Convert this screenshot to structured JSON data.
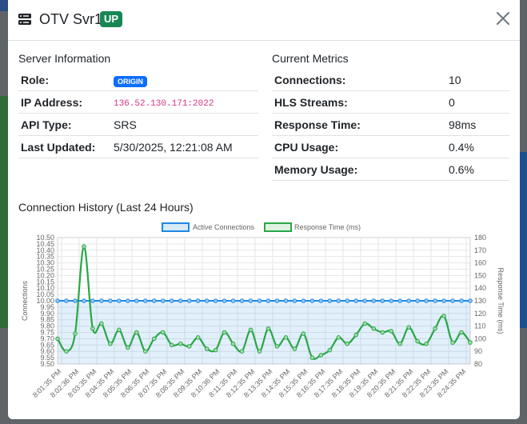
{
  "modal": {
    "title": "OTV Svr1",
    "status_badge": "UP",
    "close_icon": "close-icon",
    "server_icon": "server-icon"
  },
  "server_info": {
    "heading": "Server Information",
    "rows": [
      {
        "label": "Role:",
        "value": "ORIGIN"
      },
      {
        "label": "IP Address:",
        "value": "136.52.130.171:2022"
      },
      {
        "label": "API Type:",
        "value": "SRS"
      },
      {
        "label": "Last Updated:",
        "value": "5/30/2025, 12:21:08 AM"
      }
    ]
  },
  "metrics": {
    "heading": "Current Metrics",
    "rows": [
      {
        "label": "Connections:",
        "value": "10"
      },
      {
        "label": "HLS Streams:",
        "value": "0"
      },
      {
        "label": "Response Time:",
        "value": "98ms"
      },
      {
        "label": "CPU Usage:",
        "value": "0.4%"
      },
      {
        "label": "Memory Usage:",
        "value": "0.6%"
      }
    ]
  },
  "history": {
    "heading": "Connection History (Last 24 Hours)"
  },
  "colors": {
    "success": "#198754",
    "primary": "#0d6efd",
    "connections_line": "#1e88e5",
    "response_line": "#28a745"
  },
  "chart_data": {
    "type": "line",
    "legend_position": "top",
    "grid": true,
    "x": [
      "8:01:35 PM",
      "8:02:36 PM",
      "8:03:35 PM",
      "8:04:35 PM",
      "8:05:35 PM",
      "8:06:35 PM",
      "8:07:35 PM",
      "8:08:35 PM",
      "8:09:35 PM",
      "8:10:36 PM",
      "8:11:35 PM",
      "8:12:35 PM",
      "8:13:35 PM",
      "8:14:35 PM",
      "8:15:35 PM",
      "8:16:35 PM",
      "8:17:35 PM",
      "8:18:35 PM",
      "8:19:35 PM",
      "8:20:35 PM",
      "8:21:35 PM",
      "8:22:35 PM",
      "8:23:35 PM",
      "8:24:35 PM"
    ],
    "series": [
      {
        "name": "Active Connections",
        "axis": "left",
        "fill": true,
        "values": [
          10,
          10,
          10,
          10,
          10,
          10,
          10,
          10,
          10,
          10,
          10,
          10,
          10,
          10,
          10,
          10,
          10,
          10,
          10,
          10,
          10,
          10,
          10,
          10,
          10,
          10,
          10,
          10,
          10,
          10,
          10,
          10,
          10,
          10,
          10,
          10,
          10,
          10,
          10,
          10,
          10,
          10,
          10,
          10,
          10,
          10,
          10,
          10
        ]
      },
      {
        "name": "Response Time (ms)",
        "axis": "right",
        "fill": false,
        "values": [
          100,
          90,
          104,
          173,
          108,
          112,
          96,
          107,
          93,
          105,
          90,
          100,
          105,
          95,
          96,
          94,
          101,
          92,
          91,
          105,
          96,
          90,
          107,
          90,
          108,
          94,
          101,
          92,
          104,
          85,
          87,
          91,
          101,
          96,
          103,
          112,
          108,
          105,
          106,
          96,
          109,
          98,
          96,
          108,
          118,
          97,
          105,
          97
        ]
      }
    ],
    "yleft": {
      "label": "Connections",
      "min": 9.5,
      "max": 10.5,
      "step": 0.05
    },
    "yright": {
      "label": "Response Time (ms)",
      "min": 80,
      "max": 180,
      "step": 10
    }
  }
}
